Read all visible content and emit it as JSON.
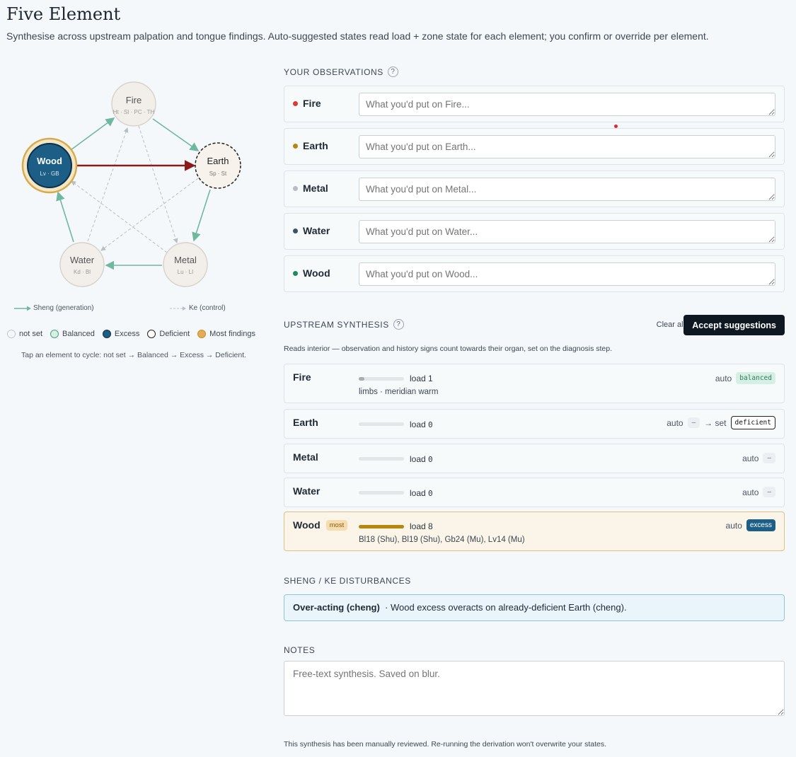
{
  "page": {
    "title": "Five Element",
    "subtitle": "Synthesise across upstream palpation and tongue findings. Auto-suggested states read load + zone state for each element; you confirm or override per element."
  },
  "diagram": {
    "nodes": {
      "fire": {
        "name": "Fire",
        "organs": "Ht · SI · PC · TH"
      },
      "earth": {
        "name": "Earth",
        "organs": "Sp · St"
      },
      "metal": {
        "name": "Metal",
        "organs": "Lu · LI"
      },
      "water": {
        "name": "Water",
        "organs": "Kd · Bl"
      },
      "wood": {
        "name": "Wood",
        "organs": "Lv · GB"
      }
    },
    "legend": {
      "sheng": "Sheng (generation)",
      "ke": "Ke (control)"
    },
    "states": {
      "not_set": "not set",
      "balanced": "Balanced",
      "excess": "Excess",
      "deficient": "Deficient",
      "most": "Most findings"
    },
    "hint": "Tap an element to cycle: not set → Balanced → Excess → Deficient.",
    "colors": {
      "sheng": "#6fb8a0",
      "ke": "#b9bec4",
      "cheng": "#8b1a1a",
      "excess": "#1d5e86",
      "most_ring": "#d9a94a",
      "node_fill": "#f2efea"
    }
  },
  "observations": {
    "heading": "Your observations",
    "help": "?",
    "rows": [
      {
        "label": "Fire",
        "color": "#d93a32",
        "placeholder": "What you'd put on Fire..."
      },
      {
        "label": "Earth",
        "color": "#b8860b",
        "placeholder": "What you'd put on Earth..."
      },
      {
        "label": "Metal",
        "color": "#b9bcc0",
        "placeholder": "What you'd put on Metal..."
      },
      {
        "label": "Water",
        "color": "#3e5266",
        "placeholder": "What you'd put on Water..."
      },
      {
        "label": "Wood",
        "color": "#1e8a5e",
        "placeholder": "What you'd put on Wood..."
      }
    ]
  },
  "synthesis": {
    "heading": "Upstream synthesis",
    "help": "?",
    "clear_label": "Clear all",
    "accept_label": "Accept suggestions",
    "note": "Reads interior — observation and history signs count towards their organ, set on the diagnosis step.",
    "rows": [
      {
        "name": "Fire",
        "load_label": "load",
        "load": "1",
        "load_fraction": 0.12,
        "detail": "limbs · meridian warm",
        "auto_label": "auto",
        "auto_state": "balanced"
      },
      {
        "name": "Earth",
        "load_label": "load",
        "load": "0",
        "load_fraction": 0,
        "auto_label": "auto",
        "auto_state": "–",
        "set_label": "→ set",
        "set_state": "deficient"
      },
      {
        "name": "Metal",
        "load_label": "load",
        "load": "0",
        "load_fraction": 0,
        "auto_label": "auto",
        "auto_state": "–"
      },
      {
        "name": "Water",
        "load_label": "load",
        "load": "0",
        "load_fraction": 0,
        "auto_label": "auto",
        "auto_state": "–"
      },
      {
        "name": "Wood",
        "badge": "most",
        "load_label": "load",
        "load": "8",
        "load_fraction": 1,
        "detail": "Bl18 (Shu), Bl19 (Shu), Gb24 (Mu), Lv14 (Mu)",
        "auto_label": "auto",
        "auto_state": "excess"
      }
    ]
  },
  "disturbances": {
    "heading": "Sheng / Ke disturbances",
    "title": "Over-acting (cheng)",
    "text": "· Wood excess overacts on already-deficient Earth (cheng)."
  },
  "notes": {
    "heading": "Notes",
    "placeholder": "Free-text synthesis. Saved on blur."
  },
  "footer": {
    "text": "This synthesis has been manually reviewed. Re-running the derivation won't overwrite your states."
  }
}
